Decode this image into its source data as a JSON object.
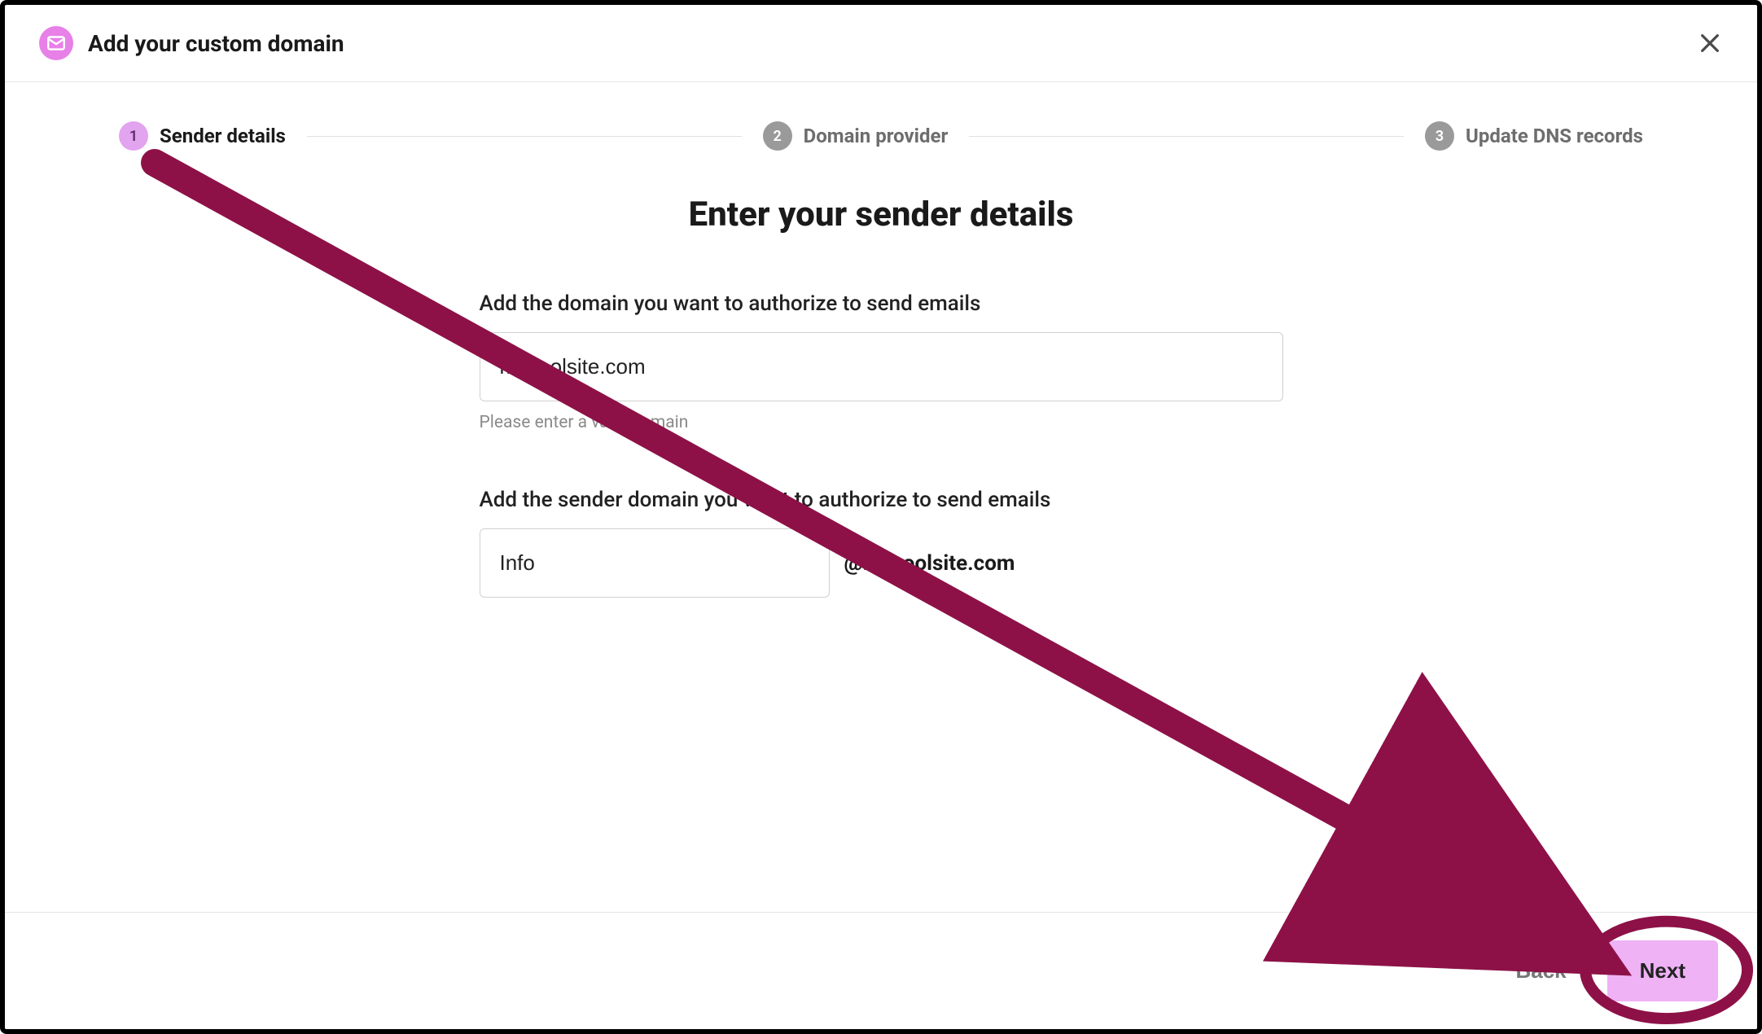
{
  "header": {
    "title": "Add your custom domain"
  },
  "stepper": {
    "steps": [
      {
        "num": "1",
        "label": "Sender details"
      },
      {
        "num": "2",
        "label": "Domain provider"
      },
      {
        "num": "3",
        "label": "Update DNS records"
      }
    ]
  },
  "main": {
    "heading": "Enter your sender details",
    "domain_field": {
      "label": "Add the domain you want to authorize to send emails",
      "value": "mycoolsite.com",
      "helper": "Please enter a valid domain"
    },
    "sender_field": {
      "label": "Add the sender domain you want to authorize to send emails",
      "value": "Info",
      "at_prefix": "@",
      "at_domain": "mycoolsite.com"
    }
  },
  "footer": {
    "back_label": "Back",
    "next_label": "Next"
  },
  "colors": {
    "accent": "#e780e7",
    "annotation": "#8d1147"
  }
}
